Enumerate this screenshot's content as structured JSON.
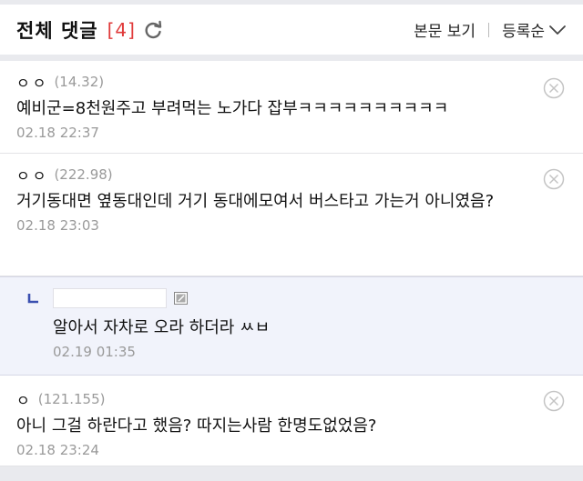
{
  "header": {
    "title": "전체 댓글",
    "count": "[4]",
    "view_post": "본문 보기",
    "sort": "등록순"
  },
  "comments": [
    {
      "author": "ㅇㅇ",
      "ip": "(14.32)",
      "text": "예비군=8천원주고 부려먹는 노가다 잡부ㅋㅋㅋㅋㅋㅋㅋㅋㅋㅋ",
      "date": "02.18 22:37"
    },
    {
      "author": "ㅇㅇ",
      "ip": "(222.98)",
      "text": "거기동대면 옆동대인데 거기 동대에모여서 버스타고 가는거 아니였음?",
      "date": "02.18 23:03"
    },
    {
      "text": "알아서 자차로 오라 하더라 ㅆㅂ",
      "date": "02.19 01:35"
    },
    {
      "author": "ㅇ",
      "ip": "(121.155)",
      "text": "아니 그걸 하란다고 했음? 따지는사람 한명도없었음?",
      "date": "02.18 23:24"
    }
  ],
  "colors": {
    "accent": "#e03a3a",
    "reply_bg": "#f1f3fb",
    "reply_mark": "#3a4fb0",
    "page_bg": "#e9eaee"
  },
  "icons": {
    "refresh": "refresh-icon",
    "sort": "chevron-down-icon",
    "delete": "close-circle-icon",
    "reply": "reply-arrow-icon",
    "edit": "edit-icon"
  }
}
